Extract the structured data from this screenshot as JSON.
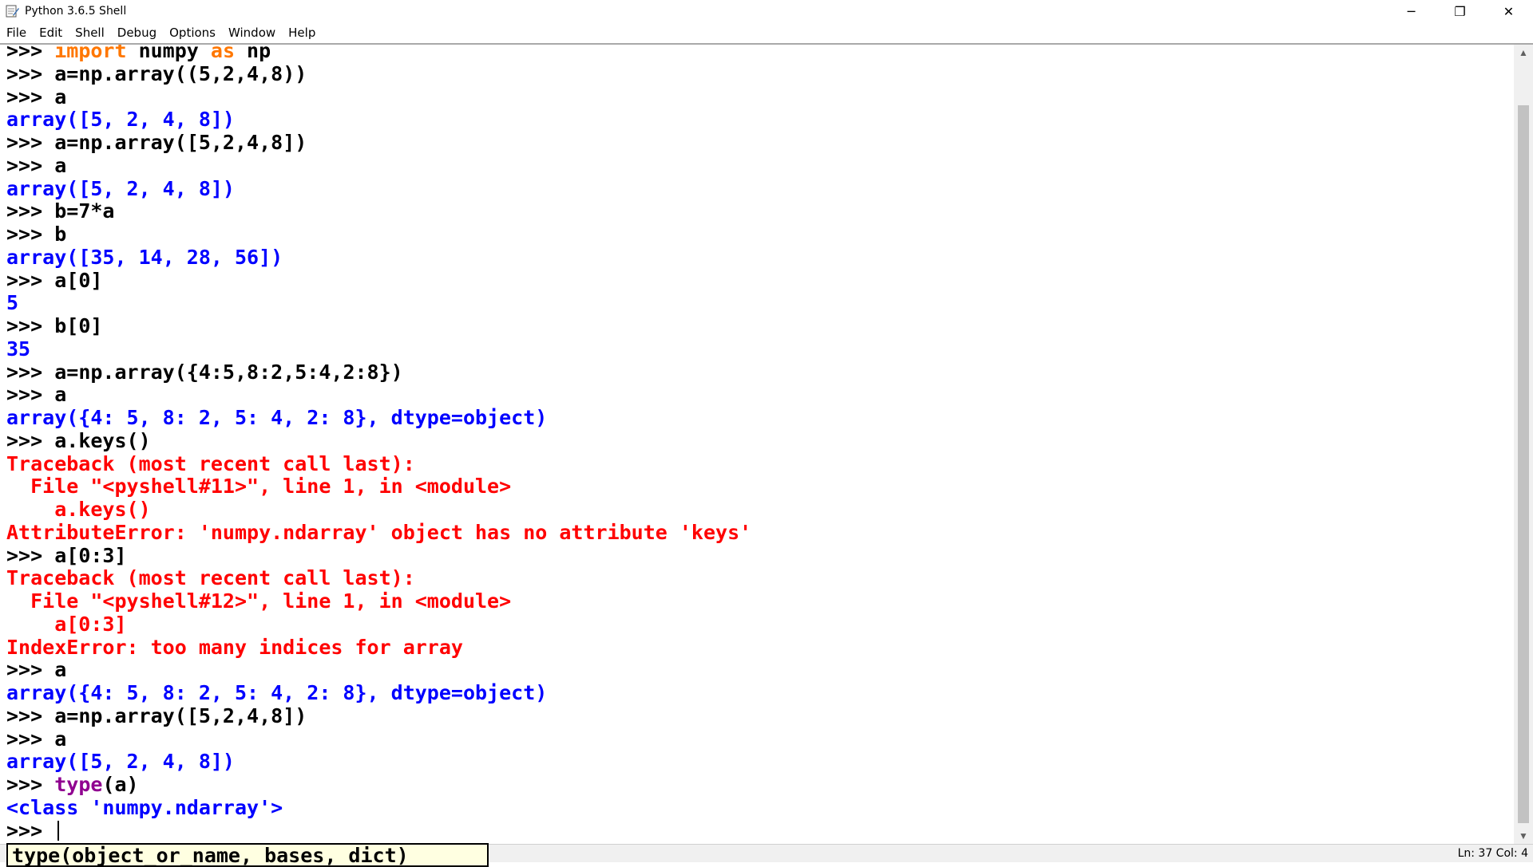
{
  "window": {
    "title": "Python 3.6.5 Shell",
    "minimize": "─",
    "restore": "❐",
    "close": "✕"
  },
  "menu": [
    "File",
    "Edit",
    "Shell",
    "Debug",
    "Options",
    "Window",
    "Help"
  ],
  "shell_lines": [
    [
      {
        "t": "prompt",
        "v": ">>> "
      },
      {
        "t": "kw",
        "v": "import"
      },
      {
        "t": "code",
        "v": " numpy "
      },
      {
        "t": "kw",
        "v": "as"
      },
      {
        "t": "code",
        "v": " np"
      }
    ],
    [
      {
        "t": "prompt",
        "v": ">>> "
      },
      {
        "t": "code",
        "v": "a=np.array((5,2,4,8))"
      }
    ],
    [
      {
        "t": "prompt",
        "v": ">>> "
      },
      {
        "t": "code",
        "v": "a"
      }
    ],
    [
      {
        "t": "out",
        "v": "array([5, 2, 4, 8])"
      }
    ],
    [
      {
        "t": "prompt",
        "v": ">>> "
      },
      {
        "t": "code",
        "v": "a=np.array([5,2,4,8])"
      }
    ],
    [
      {
        "t": "prompt",
        "v": ">>> "
      },
      {
        "t": "code",
        "v": "a"
      }
    ],
    [
      {
        "t": "out",
        "v": "array([5, 2, 4, 8])"
      }
    ],
    [
      {
        "t": "prompt",
        "v": ">>> "
      },
      {
        "t": "code",
        "v": "b=7*a"
      }
    ],
    [
      {
        "t": "prompt",
        "v": ">>> "
      },
      {
        "t": "code",
        "v": "b"
      }
    ],
    [
      {
        "t": "out",
        "v": "array([35, 14, 28, 56])"
      }
    ],
    [
      {
        "t": "prompt",
        "v": ">>> "
      },
      {
        "t": "code",
        "v": "a[0]"
      }
    ],
    [
      {
        "t": "out",
        "v": "5"
      }
    ],
    [
      {
        "t": "prompt",
        "v": ">>> "
      },
      {
        "t": "code",
        "v": "b[0]"
      }
    ],
    [
      {
        "t": "out",
        "v": "35"
      }
    ],
    [
      {
        "t": "prompt",
        "v": ">>> "
      },
      {
        "t": "code",
        "v": "a=np.array({4:5,8:2,5:4,2:8})"
      }
    ],
    [
      {
        "t": "prompt",
        "v": ">>> "
      },
      {
        "t": "code",
        "v": "a"
      }
    ],
    [
      {
        "t": "out",
        "v": "array({4: 5, 8: 2, 5: 4, 2: 8}, dtype=object)"
      }
    ],
    [
      {
        "t": "prompt",
        "v": ">>> "
      },
      {
        "t": "code",
        "v": "a.keys()"
      }
    ],
    [
      {
        "t": "err",
        "v": "Traceback (most recent call last):"
      }
    ],
    [
      {
        "t": "err",
        "v": "  File \"<pyshell#11>\", line 1, in <module>"
      }
    ],
    [
      {
        "t": "err",
        "v": "    a.keys()"
      }
    ],
    [
      {
        "t": "err",
        "v": "AttributeError: 'numpy.ndarray' object has no attribute 'keys'"
      }
    ],
    [
      {
        "t": "prompt",
        "v": ">>> "
      },
      {
        "t": "code",
        "v": "a[0:3]"
      }
    ],
    [
      {
        "t": "err",
        "v": "Traceback (most recent call last):"
      }
    ],
    [
      {
        "t": "err",
        "v": "  File \"<pyshell#12>\", line 1, in <module>"
      }
    ],
    [
      {
        "t": "err",
        "v": "    a[0:3]"
      }
    ],
    [
      {
        "t": "err",
        "v": "IndexError: too many indices for array"
      }
    ],
    [
      {
        "t": "prompt",
        "v": ">>> "
      },
      {
        "t": "code",
        "v": "a"
      }
    ],
    [
      {
        "t": "out",
        "v": "array({4: 5, 8: 2, 5: 4, 2: 8}, dtype=object)"
      }
    ],
    [
      {
        "t": "prompt",
        "v": ">>> "
      },
      {
        "t": "code",
        "v": "a=np.array([5,2,4,8])"
      }
    ],
    [
      {
        "t": "prompt",
        "v": ">>> "
      },
      {
        "t": "code",
        "v": "a"
      }
    ],
    [
      {
        "t": "out",
        "v": "array([5, 2, 4, 8])"
      }
    ],
    [
      {
        "t": "prompt",
        "v": ">>> "
      },
      {
        "t": "builtin",
        "v": "type"
      },
      {
        "t": "code",
        "v": "(a)"
      }
    ],
    [
      {
        "t": "out",
        "v": "<class 'numpy.ndarray'>"
      }
    ],
    [
      {
        "t": "prompt",
        "v": ">>> "
      },
      {
        "t": "caret",
        "v": ""
      }
    ]
  ],
  "calltip": "type(object_or_name, bases, dict)",
  "status": "Ln: 37   Col: 4",
  "colors": {
    "keyword": "#ff7700",
    "output": "#0000ff",
    "error": "#ff0000",
    "builtin": "#900090"
  }
}
